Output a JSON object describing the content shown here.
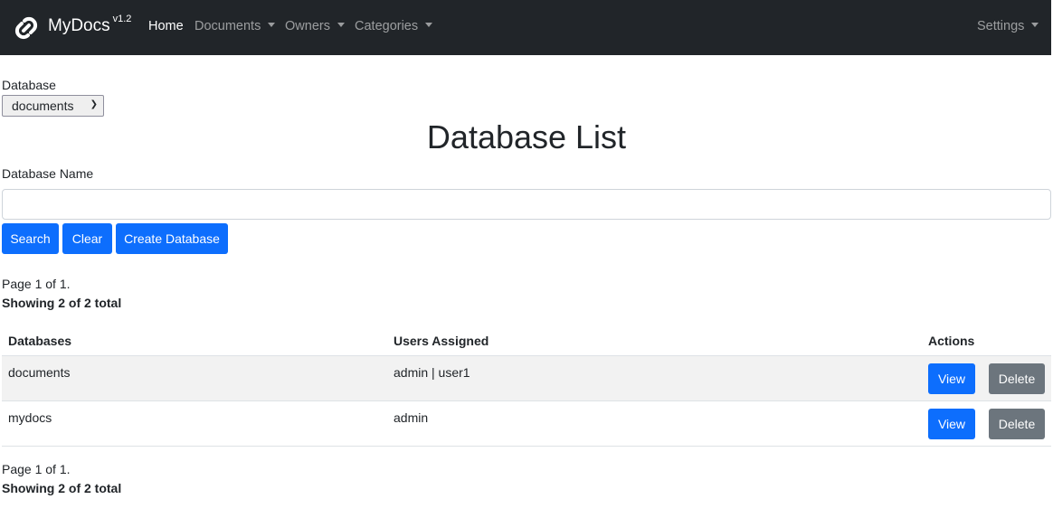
{
  "navbar": {
    "brand": "MyDocs",
    "version": "v1.2",
    "items": [
      {
        "label": "Home",
        "active": true,
        "dropdown": false
      },
      {
        "label": "Documents",
        "dropdown": true
      },
      {
        "label": "Owners",
        "dropdown": true
      },
      {
        "label": "Categories",
        "dropdown": true
      }
    ],
    "settings": "Settings",
    "colors": {
      "background": "#212529",
      "active": "#ffffff"
    }
  },
  "database_select": {
    "label": "Database",
    "value": "documents"
  },
  "page_title": "Database List",
  "search_form": {
    "label": "Database Name",
    "value": "",
    "buttons": {
      "search": "Search",
      "clear": "Clear",
      "create": "Create Database"
    }
  },
  "pagination_top": {
    "page": "Page 1 of 1.",
    "showing": "Showing 2 of 2 total"
  },
  "table": {
    "headers": [
      "Databases",
      "Users Assigned",
      "Actions"
    ],
    "rows": [
      {
        "database": "documents",
        "users": "admin | user1",
        "view": "View",
        "delete": "Delete"
      },
      {
        "database": "mydocs",
        "users": "admin",
        "view": "View",
        "delete": "Delete"
      }
    ]
  },
  "pagination_bottom": {
    "page": "Page 1 of 1.",
    "showing": "Showing 2 of 2 total"
  },
  "colors": {
    "primary": "#0d6efd",
    "secondary": "#6c757d",
    "stripe": "#f2f2f2"
  }
}
